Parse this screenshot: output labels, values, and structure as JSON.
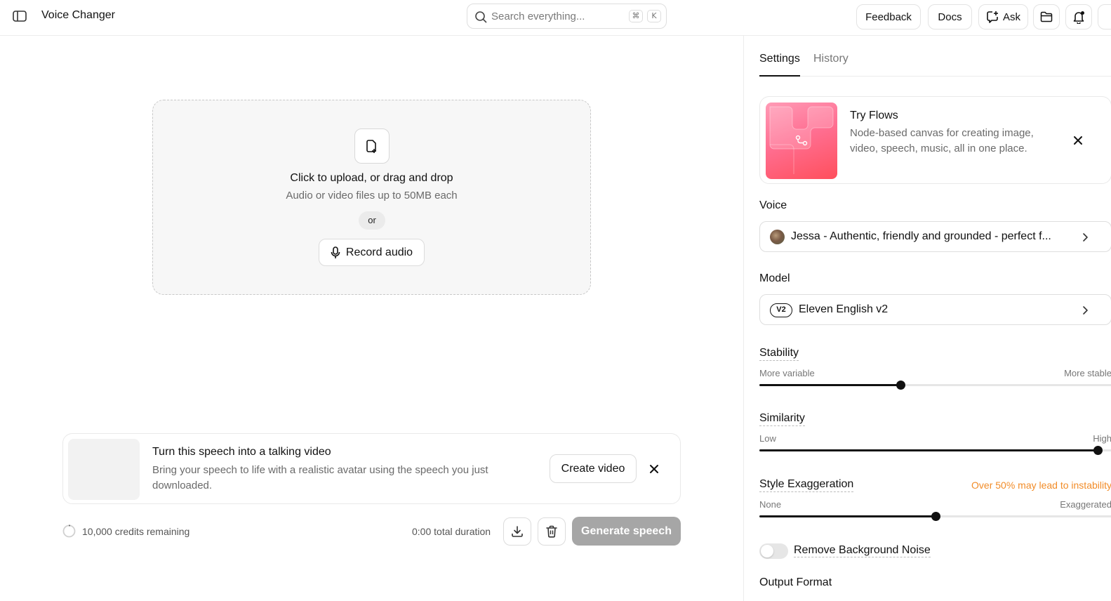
{
  "header": {
    "title": "Voice Changer",
    "search_placeholder": "Search everything...",
    "search_kbd_cmd": "⌘",
    "search_kbd_key": "K",
    "feedback_label": "Feedback",
    "docs_label": "Docs",
    "ask_label": "Ask"
  },
  "upload": {
    "title": "Click to upload, or drag and drop",
    "subtitle": "Audio or video files up to 50MB each",
    "or_label": "or",
    "record_label": "Record audio"
  },
  "promo": {
    "title": "Turn this speech into a talking video",
    "description": "Bring your speech to life with a realistic avatar using the speech you just downloaded.",
    "button_label": "Create video"
  },
  "footer": {
    "credits": "10,000 credits remaining",
    "duration": "0:00 total duration",
    "generate_label": "Generate speech"
  },
  "panel": {
    "tabs": [
      {
        "label": "Settings",
        "active": true
      },
      {
        "label": "History",
        "active": false
      }
    ],
    "flows": {
      "title": "Try Flows",
      "description": "Node-based canvas for creating image, video, speech, music, all in one place."
    },
    "voice": {
      "label": "Voice",
      "value": "Jessa - Authentic, friendly and grounded - perfect f..."
    },
    "model": {
      "label": "Model",
      "badge": "V2",
      "value": "Eleven English v2"
    },
    "stability": {
      "label": "Stability",
      "min_label": "More variable",
      "max_label": "More stable",
      "value": 0.4
    },
    "similarity": {
      "label": "Similarity",
      "min_label": "Low",
      "max_label": "High",
      "value": 0.96
    },
    "style": {
      "label": "Style Exaggeration",
      "warning": "Over 50% may lead to instability",
      "min_label": "None",
      "max_label": "Exaggerated",
      "value": 0.5
    },
    "noise": {
      "label": "Remove Background Noise",
      "enabled": false
    },
    "output_format": {
      "label": "Output Format"
    }
  },
  "colors": {
    "accent": "#111111",
    "warning": "#f28c28",
    "generate_disabled": "#a6a6a6"
  },
  "icons": [
    "sidebar-toggle-icon",
    "search-icon",
    "ask-plus-icon",
    "folder-icon",
    "bell-icon",
    "upload-file-icon",
    "microphone-icon",
    "close-icon",
    "download-icon",
    "trash-icon",
    "chevron-right-icon"
  ]
}
